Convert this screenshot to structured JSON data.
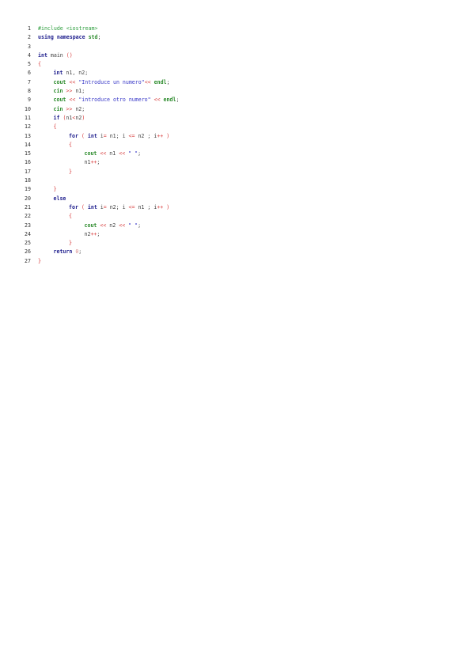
{
  "colors": {
    "preprocessor": "#2e9e3e",
    "keyword": "#1c1c8c",
    "identifier": "#2a8a2a",
    "string": "#3a3ac8",
    "number": "#d88a8a",
    "operator": "#d84040",
    "brace": "#d84040",
    "plain": "#444444"
  },
  "lines": [
    {
      "n": "1",
      "indent": 0,
      "tokens": [
        {
          "t": "pre",
          "v": "#include <iostream>"
        }
      ]
    },
    {
      "n": "2",
      "indent": 0,
      "tokens": [
        {
          "t": "kw",
          "v": "using"
        },
        {
          "t": "plain",
          "v": " "
        },
        {
          "t": "kw",
          "v": "namespace"
        },
        {
          "t": "plain",
          "v": " "
        },
        {
          "t": "id",
          "v": "std"
        },
        {
          "t": "plain",
          "v": ";"
        }
      ]
    },
    {
      "n": "3",
      "indent": 0,
      "tokens": []
    },
    {
      "n": "4",
      "indent": 0,
      "tokens": [
        {
          "t": "kw",
          "v": "int"
        },
        {
          "t": "plain",
          "v": " main "
        },
        {
          "t": "op",
          "v": "()"
        }
      ]
    },
    {
      "n": "5",
      "indent": 0,
      "tokens": [
        {
          "t": "brace",
          "v": "{"
        }
      ]
    },
    {
      "n": "6",
      "indent": 1,
      "tokens": [
        {
          "t": "kw",
          "v": "int"
        },
        {
          "t": "plain",
          "v": " n1, n2;"
        }
      ]
    },
    {
      "n": "7",
      "indent": 1,
      "tokens": [
        {
          "t": "id",
          "v": "cout"
        },
        {
          "t": "plain",
          "v": " "
        },
        {
          "t": "op",
          "v": "<<"
        },
        {
          "t": "plain",
          "v": " "
        },
        {
          "t": "str",
          "v": "\"Introduce un numero\""
        },
        {
          "t": "op",
          "v": "<<"
        },
        {
          "t": "plain",
          "v": " "
        },
        {
          "t": "id",
          "v": "endl"
        },
        {
          "t": "plain",
          "v": ";"
        }
      ]
    },
    {
      "n": "8",
      "indent": 1,
      "tokens": [
        {
          "t": "id",
          "v": "cin"
        },
        {
          "t": "plain",
          "v": " "
        },
        {
          "t": "op",
          "v": ">>"
        },
        {
          "t": "plain",
          "v": " n1;"
        }
      ]
    },
    {
      "n": "9",
      "indent": 1,
      "tokens": [
        {
          "t": "id",
          "v": "cout"
        },
        {
          "t": "plain",
          "v": " "
        },
        {
          "t": "op",
          "v": "<<"
        },
        {
          "t": "plain",
          "v": " "
        },
        {
          "t": "str",
          "v": "\"introduce otro numero\""
        },
        {
          "t": "plain",
          "v": " "
        },
        {
          "t": "op",
          "v": "<<"
        },
        {
          "t": "plain",
          "v": " "
        },
        {
          "t": "id",
          "v": "endl"
        },
        {
          "t": "plain",
          "v": ";"
        }
      ]
    },
    {
      "n": "10",
      "indent": 1,
      "tokens": [
        {
          "t": "id",
          "v": "cin"
        },
        {
          "t": "plain",
          "v": " "
        },
        {
          "t": "op",
          "v": ">>"
        },
        {
          "t": "plain",
          "v": " n2;"
        }
      ]
    },
    {
      "n": "11",
      "indent": 1,
      "tokens": [
        {
          "t": "kw",
          "v": "if"
        },
        {
          "t": "plain",
          "v": " "
        },
        {
          "t": "op",
          "v": "("
        },
        {
          "t": "plain",
          "v": "n1"
        },
        {
          "t": "op",
          "v": "<"
        },
        {
          "t": "plain",
          "v": "n2"
        },
        {
          "t": "op",
          "v": ")"
        }
      ]
    },
    {
      "n": "12",
      "indent": 1,
      "tokens": [
        {
          "t": "brace",
          "v": "{"
        }
      ]
    },
    {
      "n": "13",
      "indent": 2,
      "tokens": [
        {
          "t": "kw",
          "v": "for"
        },
        {
          "t": "plain",
          "v": " "
        },
        {
          "t": "op",
          "v": "("
        },
        {
          "t": "plain",
          "v": " "
        },
        {
          "t": "kw",
          "v": "int"
        },
        {
          "t": "plain",
          "v": " i"
        },
        {
          "t": "op",
          "v": "="
        },
        {
          "t": "plain",
          "v": " n1; i "
        },
        {
          "t": "op",
          "v": "<="
        },
        {
          "t": "plain",
          "v": " n2 ; i"
        },
        {
          "t": "op",
          "v": "++"
        },
        {
          "t": "plain",
          "v": " "
        },
        {
          "t": "op",
          "v": ")"
        }
      ]
    },
    {
      "n": "14",
      "indent": 2,
      "tokens": [
        {
          "t": "brace",
          "v": "{"
        }
      ]
    },
    {
      "n": "15",
      "indent": 3,
      "tokens": [
        {
          "t": "id",
          "v": "cout"
        },
        {
          "t": "plain",
          "v": " "
        },
        {
          "t": "op",
          "v": "<<"
        },
        {
          "t": "plain",
          "v": " n1 "
        },
        {
          "t": "op",
          "v": "<<"
        },
        {
          "t": "plain",
          "v": " "
        },
        {
          "t": "str",
          "v": "\" \""
        },
        {
          "t": "plain",
          "v": ";"
        }
      ]
    },
    {
      "n": "16",
      "indent": 3,
      "tokens": [
        {
          "t": "plain",
          "v": "n1"
        },
        {
          "t": "op",
          "v": "++"
        },
        {
          "t": "plain",
          "v": ";"
        }
      ]
    },
    {
      "n": "17",
      "indent": 2,
      "tokens": [
        {
          "t": "brace",
          "v": "}"
        }
      ]
    },
    {
      "n": "18",
      "indent": 0,
      "tokens": []
    },
    {
      "n": "19",
      "indent": 1,
      "tokens": [
        {
          "t": "brace",
          "v": "}"
        }
      ]
    },
    {
      "n": "20",
      "indent": 1,
      "tokens": [
        {
          "t": "kw",
          "v": "else"
        }
      ]
    },
    {
      "n": "21",
      "indent": 2,
      "tokens": [
        {
          "t": "kw",
          "v": "for"
        },
        {
          "t": "plain",
          "v": " "
        },
        {
          "t": "op",
          "v": "("
        },
        {
          "t": "plain",
          "v": " "
        },
        {
          "t": "kw",
          "v": "int"
        },
        {
          "t": "plain",
          "v": " i"
        },
        {
          "t": "op",
          "v": "="
        },
        {
          "t": "plain",
          "v": " n2; i "
        },
        {
          "t": "op",
          "v": "<="
        },
        {
          "t": "plain",
          "v": " n1 ; i"
        },
        {
          "t": "op",
          "v": "++"
        },
        {
          "t": "plain",
          "v": " "
        },
        {
          "t": "op",
          "v": ")"
        }
      ]
    },
    {
      "n": "22",
      "indent": 2,
      "tokens": [
        {
          "t": "brace",
          "v": "{"
        }
      ]
    },
    {
      "n": "23",
      "indent": 3,
      "tokens": [
        {
          "t": "id",
          "v": "cout"
        },
        {
          "t": "plain",
          "v": " "
        },
        {
          "t": "op",
          "v": "<<"
        },
        {
          "t": "plain",
          "v": " n2 "
        },
        {
          "t": "op",
          "v": "<<"
        },
        {
          "t": "plain",
          "v": " "
        },
        {
          "t": "str",
          "v": "\" \""
        },
        {
          "t": "plain",
          "v": ";"
        }
      ]
    },
    {
      "n": "24",
      "indent": 3,
      "tokens": [
        {
          "t": "plain",
          "v": "n2"
        },
        {
          "t": "op",
          "v": "++"
        },
        {
          "t": "plain",
          "v": ";"
        }
      ]
    },
    {
      "n": "25",
      "indent": 2,
      "tokens": [
        {
          "t": "brace",
          "v": "}"
        }
      ]
    },
    {
      "n": "26",
      "indent": 1,
      "tokens": [
        {
          "t": "kw",
          "v": "return"
        },
        {
          "t": "plain",
          "v": " "
        },
        {
          "t": "num",
          "v": "0"
        },
        {
          "t": "plain",
          "v": ";"
        }
      ]
    },
    {
      "n": "27",
      "indent": 0,
      "tokens": [
        {
          "t": "brace",
          "v": "}"
        }
      ]
    }
  ]
}
